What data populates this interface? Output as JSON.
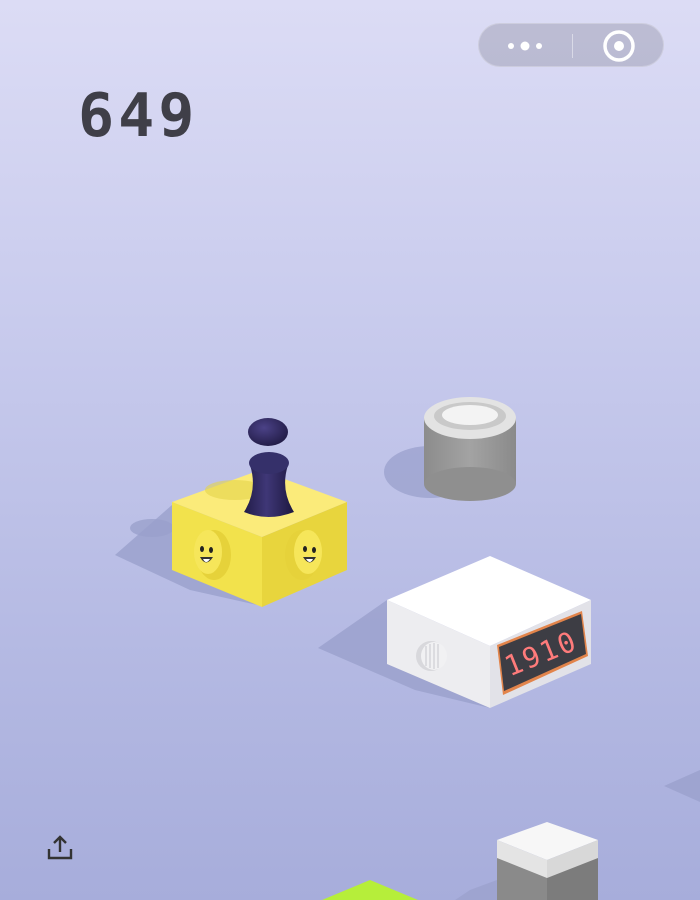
{
  "game": {
    "score": "649",
    "clock_time": "1910"
  },
  "icons": {
    "menu": "more-dots-icon",
    "close": "target-close-icon",
    "share": "share-upload-icon"
  },
  "colors": {
    "background_top": "#dcdcf5",
    "background_bottom": "#a7addb",
    "score_color": "#3f3f48",
    "yellow_box": "#f2e24c",
    "player": "#2b2450",
    "clock_digits": "#ff6a6a",
    "green_tile": "#b6ee3a"
  }
}
